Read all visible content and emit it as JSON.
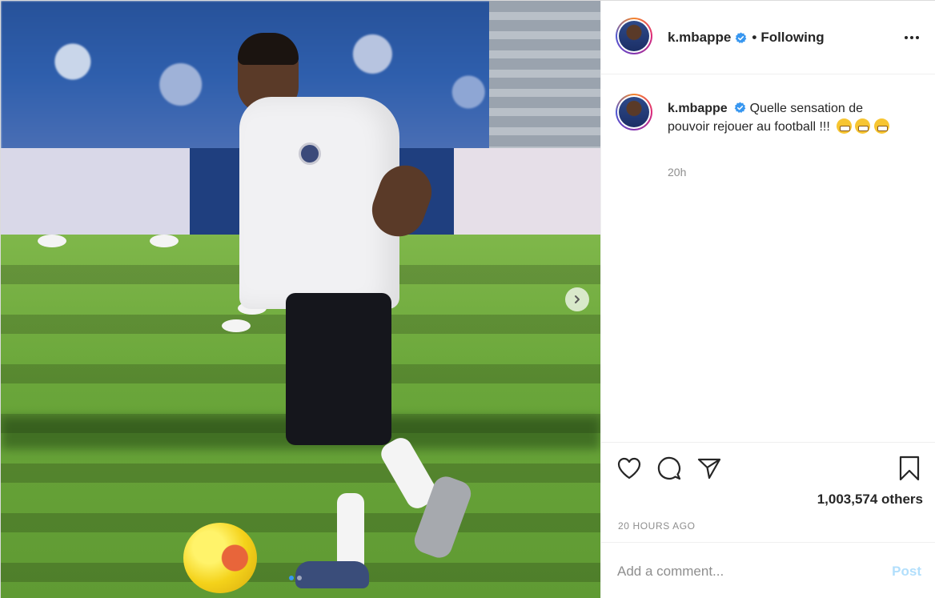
{
  "post": {
    "username": "k.mbappe",
    "follow_status": "Following",
    "separator": "•",
    "caption_text": "Quelle sensation de pouvoir rejouer au football !!!",
    "caption_emojis": [
      "grin-emoji",
      "grin-emoji",
      "grin-emoji"
    ],
    "caption_age": "20h",
    "likes_text": "1,003,574 others",
    "timestamp": "20 HOURS AGO"
  },
  "media": {
    "carousel_total": 2,
    "carousel_current": 1
  },
  "comment": {
    "placeholder": "Add a comment...",
    "post_label": "Post"
  },
  "icons": {
    "verified": "verified-badge-icon",
    "more": "more-options-icon",
    "like": "heart-icon",
    "comment": "comment-bubble-icon",
    "share": "paper-plane-icon",
    "save": "bookmark-icon",
    "next": "chevron-right-icon"
  },
  "colors": {
    "verified_blue": "#3897f0",
    "post_disabled": "#b2dffc",
    "muted_text": "#8e8e8e",
    "primary_text": "#262626"
  }
}
